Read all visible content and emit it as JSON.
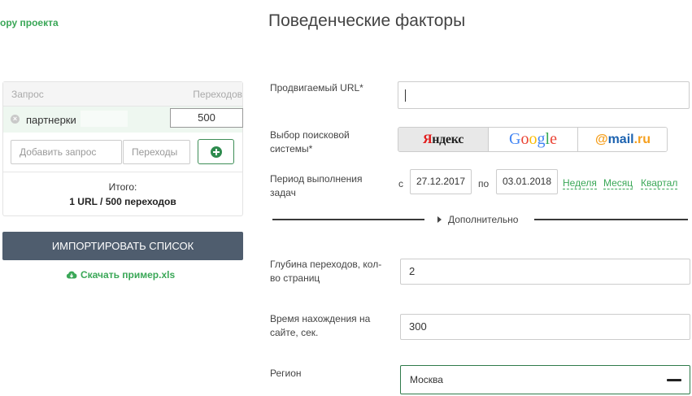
{
  "header": {
    "back_link": "ору проекта",
    "title": "Поведенческие факторы"
  },
  "queries": {
    "col_query": "Запрос",
    "col_clicks": "Переходов",
    "rows": [
      {
        "query": "партнерки",
        "clicks": "500"
      }
    ],
    "add_query_placeholder": "Добавить запрос",
    "add_clicks_placeholder": "Переходы",
    "total_label": "Итого:",
    "total_value": "1 URL / 500 переходов"
  },
  "actions": {
    "import_label": "ИМПОРТИРОВАТЬ СПИСОК",
    "download_label": "Скачать пример.xls"
  },
  "form": {
    "url_label": "Продвигаемый URL*",
    "url_value": "",
    "engine_label": "Выбор поисковой системы*",
    "engines": {
      "yandex": "Яндекс",
      "google": "Google",
      "mail": "@mail.ru",
      "selected": "Яндекс"
    },
    "period_label": "Период выполнения задач",
    "from_prefix": "с",
    "date_from": "27.12.2017",
    "to_prefix": "по",
    "date_to": "03.01.2018",
    "period_links": [
      "Неделя",
      "Месяц",
      "Квартал"
    ],
    "advanced_label": "Дополнительно",
    "depth_label": "Глубина переходов, кол-во страниц",
    "depth_value": "2",
    "time_label": "Время нахождения на сайте, сек.",
    "time_value": "300",
    "region_label": "Регион",
    "region_value": "Москва"
  },
  "colors": {
    "accent_green": "#3aa757",
    "import_button": "#4f5d6e",
    "yandex_red": "#e21b1b",
    "mail_orange": "#f59f1d",
    "mail_blue": "#1d63b0"
  }
}
